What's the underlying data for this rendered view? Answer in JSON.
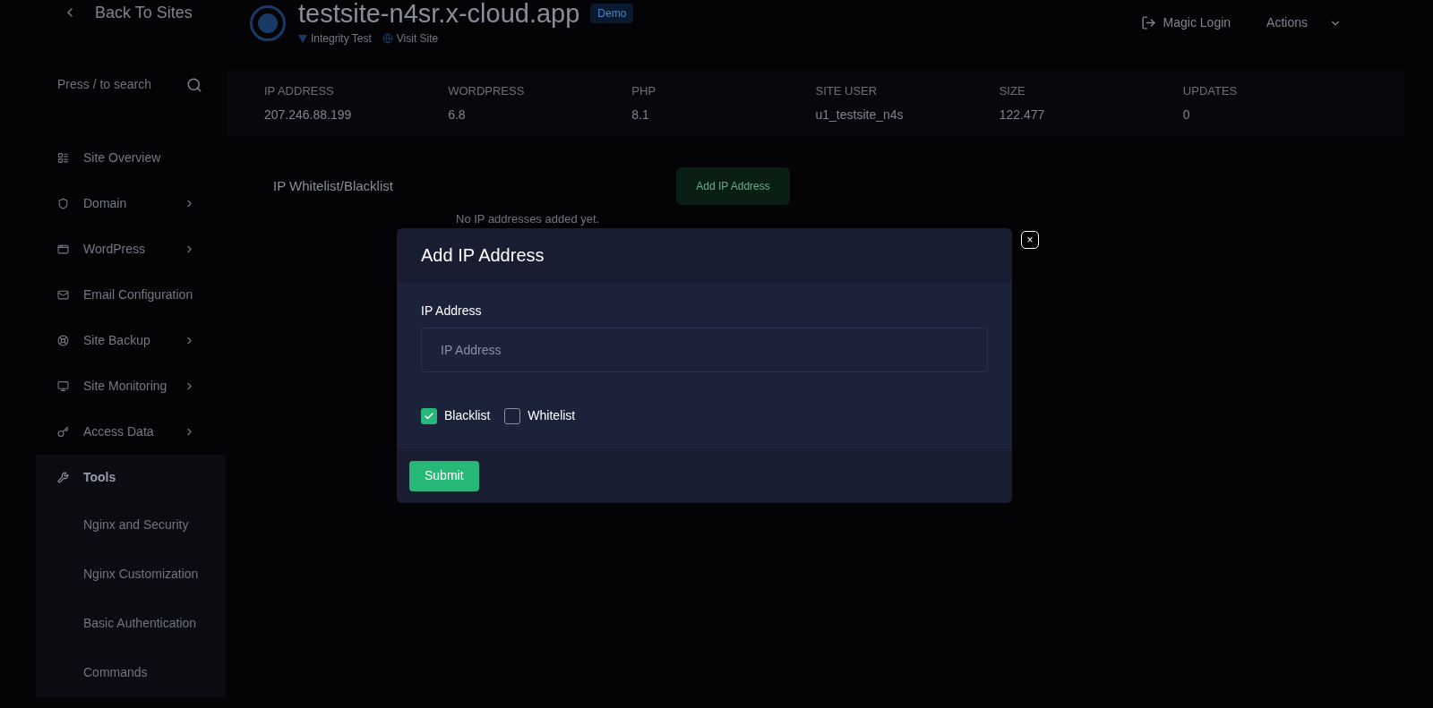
{
  "back_link": "Back To Sites",
  "site": {
    "title": "testsite-n4sr.x-cloud.app",
    "badge": "Demo",
    "links": [
      "Integrity Test",
      "Visit Site"
    ]
  },
  "header_actions": {
    "magic_login": "Magic Login",
    "actions": "Actions"
  },
  "search": {
    "placeholder": "Press / to search"
  },
  "sidebar": {
    "items": [
      {
        "label": "Site Overview",
        "selected": false
      },
      {
        "label": "Domain",
        "has_submenu": true,
        "selected": false
      },
      {
        "label": "WordPress",
        "has_submenu": true,
        "selected": false
      },
      {
        "label": "Email Configuration",
        "selected": false
      },
      {
        "label": "Site Backup",
        "has_submenu": true,
        "selected": false
      },
      {
        "label": "Site Monitoring",
        "has_submenu": true,
        "selected": false
      },
      {
        "label": "Access Data",
        "has_submenu": true,
        "selected": false
      },
      {
        "label": "Tools",
        "selected": true,
        "children": [
          {
            "label": "Nginx and Security"
          },
          {
            "label": "Nginx Customization"
          },
          {
            "label": "Basic Authentication"
          },
          {
            "label": "Commands"
          }
        ]
      }
    ]
  },
  "stats": [
    {
      "label": "IP ADDRESS",
      "value": "207.246.88.199"
    },
    {
      "label": "WORDPRESS",
      "value": "6.8"
    },
    {
      "label": "PHP",
      "value": "8.1"
    },
    {
      "label": "SITE USER",
      "value": "u1_testsite_n4s"
    },
    {
      "label": "SIZE",
      "value": "122.477"
    },
    {
      "label": "UPDATES",
      "value": "0"
    }
  ],
  "section": {
    "title": "IP Whitelist/Blacklist",
    "add_button": "Add IP Address",
    "empty_text": "No IP addresses added yet."
  },
  "modal": {
    "title": "Add IP Address",
    "field_label": "IP Address",
    "placeholder": "IP Address",
    "options": [
      {
        "label": "Blacklist",
        "checked": true
      },
      {
        "label": "Whitelist",
        "checked": false
      }
    ],
    "submit": "Submit",
    "close": "×"
  }
}
